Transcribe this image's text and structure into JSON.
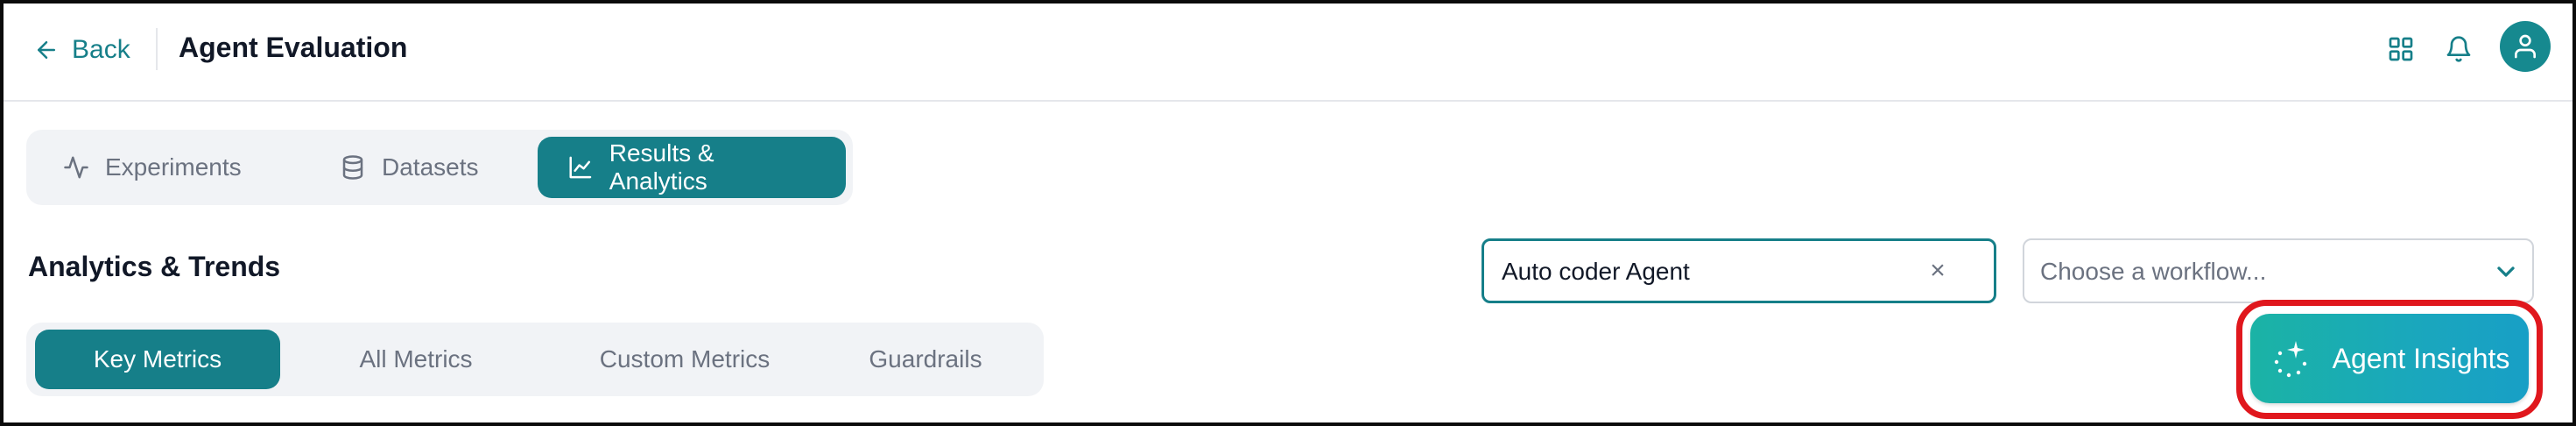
{
  "header": {
    "back_label": "Back",
    "title": "Agent Evaluation"
  },
  "tabs": [
    {
      "label": "Experiments",
      "icon": "activity-icon",
      "active": false
    },
    {
      "label": "Datasets",
      "icon": "database-icon",
      "active": false
    },
    {
      "label": "Results & Analytics",
      "icon": "line-chart-icon",
      "active": true
    }
  ],
  "section": {
    "title": "Analytics & Trends"
  },
  "agent_search": {
    "value": "Auto coder Agent",
    "clear_icon": "×"
  },
  "workflow_select": {
    "placeholder": "Choose a workflow..."
  },
  "metric_tabs": [
    {
      "label": "Key Metrics",
      "active": true
    },
    {
      "label": "All Metrics",
      "active": false
    },
    {
      "label": "Custom Metrics",
      "active": false
    },
    {
      "label": "Guardrails",
      "active": false
    }
  ],
  "insights_button": {
    "label": "Agent Insights"
  },
  "colors": {
    "accent": "#167f89",
    "highlight": "#e0171d",
    "gradient_start": "#1bb3a5",
    "gradient_end": "#189fc6"
  }
}
